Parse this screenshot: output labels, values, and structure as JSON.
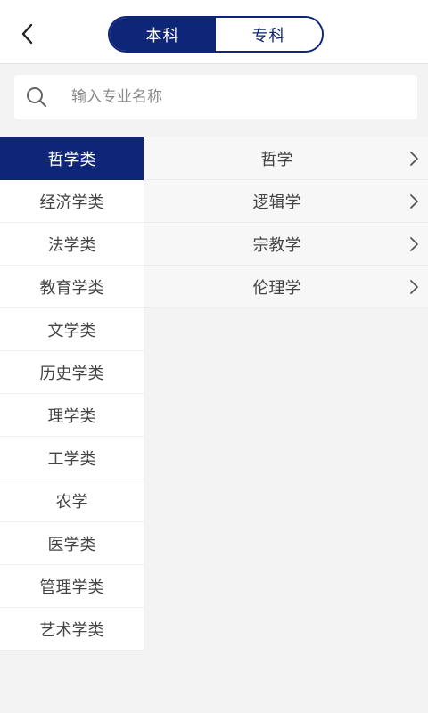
{
  "header": {
    "back_icon": "chevron-left-icon",
    "tabs": [
      {
        "label": "本科",
        "active": true
      },
      {
        "label": "专科",
        "active": false
      }
    ]
  },
  "search": {
    "icon": "search-icon",
    "placeholder": "输入专业名称",
    "value": ""
  },
  "categories": [
    {
      "label": "哲学类",
      "selected": true
    },
    {
      "label": "经济学类",
      "selected": false
    },
    {
      "label": "法学类",
      "selected": false
    },
    {
      "label": "教育学类",
      "selected": false
    },
    {
      "label": "文学类",
      "selected": false
    },
    {
      "label": "历史学类",
      "selected": false
    },
    {
      "label": "理学类",
      "selected": false
    },
    {
      "label": "工学类",
      "selected": false
    },
    {
      "label": "农学",
      "selected": false
    },
    {
      "label": "医学类",
      "selected": false
    },
    {
      "label": "管理学类",
      "selected": false
    },
    {
      "label": "艺术学类",
      "selected": false
    }
  ],
  "majors": [
    {
      "label": "哲学",
      "icon": "chevron-right-icon"
    },
    {
      "label": "逻辑学",
      "icon": "chevron-right-icon"
    },
    {
      "label": "宗教学",
      "icon": "chevron-right-icon"
    },
    {
      "label": "伦理学",
      "icon": "chevron-right-icon"
    }
  ],
  "colors": {
    "brand": "#0e2578",
    "background": "#f3f3f3"
  }
}
